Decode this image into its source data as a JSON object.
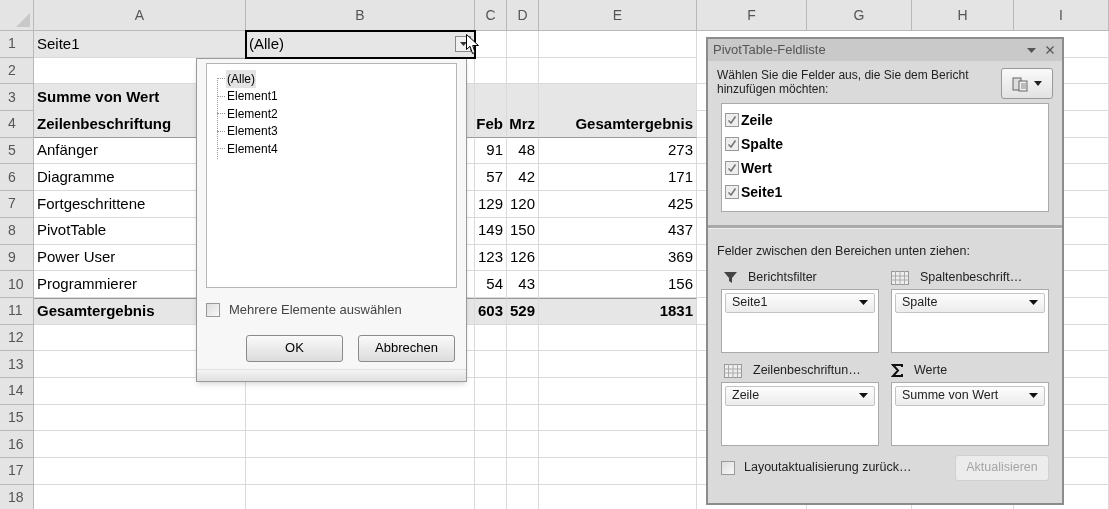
{
  "sheet": {
    "columns": [
      "A",
      "B",
      "C",
      "D",
      "E",
      "F",
      "G",
      "H",
      "I"
    ],
    "rows": [
      {
        "number": "1",
        "kind": "filter",
        "label": "Seite1",
        "filter_value": "(Alle)",
        "selected": true
      },
      {
        "number": "2",
        "kind": "blank"
      },
      {
        "number": "3",
        "kind": "header",
        "label": "Summe von Wert"
      },
      {
        "number": "4",
        "kind": "header",
        "label": "Zeilenbeschriftung",
        "values": [
          "Feb",
          "Mrz",
          "Gesamtergebnis"
        ]
      },
      {
        "number": "5",
        "kind": "data",
        "label": "Anfänger",
        "values": [
          "91",
          "48",
          "273"
        ]
      },
      {
        "number": "6",
        "kind": "data",
        "label": "Diagramme",
        "values": [
          "57",
          "42",
          "171"
        ]
      },
      {
        "number": "7",
        "kind": "data",
        "label": "Fortgeschrittene",
        "values": [
          "129",
          "120",
          "425"
        ]
      },
      {
        "number": "8",
        "kind": "data",
        "label": "PivotTable",
        "values": [
          "149",
          "150",
          "437"
        ]
      },
      {
        "number": "9",
        "kind": "data",
        "label": "Power User",
        "values": [
          "123",
          "126",
          "369"
        ]
      },
      {
        "number": "10",
        "kind": "data",
        "label": "Programmierer",
        "values": [
          "54",
          "43",
          "156"
        ]
      },
      {
        "number": "11",
        "kind": "total",
        "label": "Gesamtergebnis",
        "values": [
          "603",
          "529",
          "1831"
        ]
      },
      {
        "number": "12",
        "kind": "blank"
      },
      {
        "number": "13",
        "kind": "blank"
      },
      {
        "number": "14",
        "kind": "blank"
      },
      {
        "number": "15",
        "kind": "blank"
      },
      {
        "number": "16",
        "kind": "blank"
      },
      {
        "number": "17",
        "kind": "blank"
      },
      {
        "number": "18",
        "kind": "blank"
      }
    ]
  },
  "filter_dropdown": {
    "items": [
      {
        "label": "(Alle)",
        "selected": true
      },
      {
        "label": "Element1",
        "selected": false
      },
      {
        "label": "Element2",
        "selected": false
      },
      {
        "label": "Element3",
        "selected": false
      },
      {
        "label": "Element4",
        "selected": false
      }
    ],
    "multi_select": {
      "label": "Mehrere Elemente auswählen",
      "checked": false
    },
    "buttons": [
      "OK",
      "Abbrechen"
    ]
  },
  "field_list": {
    "title": "PivotTable-Feldliste",
    "instruction": "Wählen Sie die Felder aus, die Sie dem Bericht hinzufügen möchten:",
    "fields": [
      {
        "label": "Zeile",
        "checked": true
      },
      {
        "label": "Spalte",
        "checked": true
      },
      {
        "label": "Wert",
        "checked": true
      },
      {
        "label": "Seite1",
        "checked": true
      }
    ],
    "areas_heading": "Felder zwischen den Bereichen unten ziehen:",
    "areas": [
      {
        "kind": "filter",
        "label": "Berichtsfilter",
        "field": "Seite1"
      },
      {
        "kind": "columns",
        "label": "Spaltenbeschrift…",
        "field": "Spalte"
      },
      {
        "kind": "rows",
        "label": "Zeilenbeschriftun…",
        "field": "Zeile"
      },
      {
        "kind": "values",
        "label": "Werte",
        "field": "Summe von Wert"
      }
    ],
    "defer_update": {
      "label": "Layoutaktualisierung zurück…",
      "checked": false
    },
    "update_button": {
      "label": "Aktualisieren",
      "disabled": true
    }
  }
}
